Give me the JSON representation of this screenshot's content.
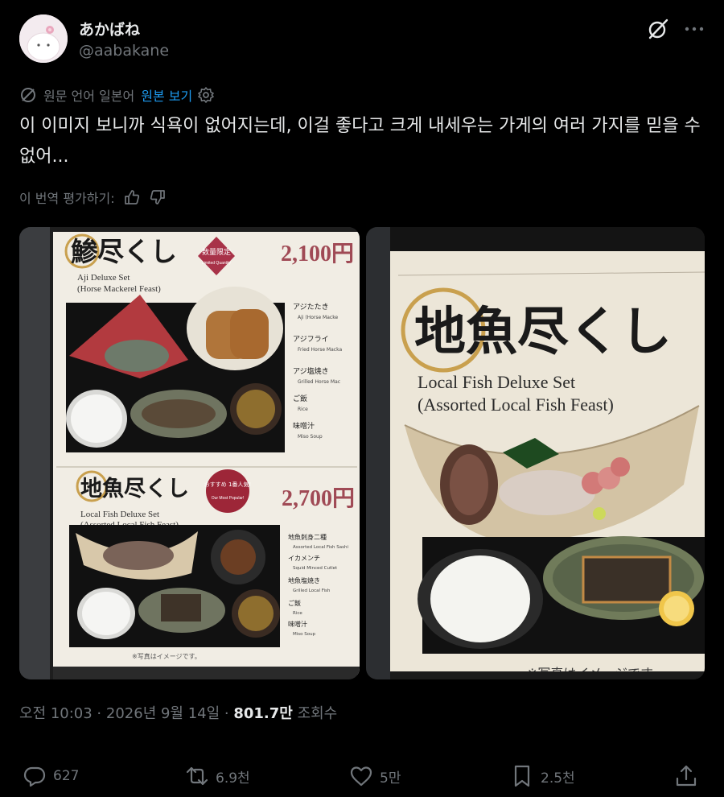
{
  "author": {
    "display_name": "あかばね",
    "handle": "@aabakane"
  },
  "translation": {
    "source_language": "원문 언어 일본어",
    "show_original": "원본 보기",
    "rate_label": "이 번역 평가하기:"
  },
  "tweet": {
    "text": "이 이미지 보니까 식욕이 없어지는데, 이걸 좋다고 크게 내세우는 가게의 여러 가지를 믿을 수 없어..."
  },
  "photo_left": {
    "set1_title": "鯵尽くし",
    "set1_en": "Aji Deluxe Set",
    "set1_en_sub": "(Horse Mackerel Feast)",
    "set1_badge": "数量限定",
    "set1_badge_en": "Limited Quantity",
    "set1_price": "2,100円",
    "set1_items": [
      {
        "jp": "アジたたき",
        "en": "Aji (Horse Macke"
      },
      {
        "jp": "アジフライ",
        "en": "Fried Horse Macka"
      },
      {
        "jp": "アジ塩焼き",
        "en": "Grilled Horse Mac"
      },
      {
        "jp": "ご飯",
        "en": "Rice"
      },
      {
        "jp": "味噌汁",
        "en": "Miso Soup"
      }
    ],
    "set2_title": "地魚尽くし",
    "set2_en": "Local Fish Deluxe Set",
    "set2_en_sub": "(Assorted Local Fish Feast)",
    "set2_badge": "おすすめ 1番人気!",
    "set2_badge_en": "Our Most Popular!",
    "set2_price": "2,700円",
    "set2_items": [
      {
        "jp": "地魚刺身二種",
        "en": "Assorted Local Fish Sashi"
      },
      {
        "jp": "イカメンチ",
        "en": "Squid Minced Cutlet"
      },
      {
        "jp": "地魚塩焼き",
        "en": "Grilled Local Fish"
      },
      {
        "jp": "ご飯",
        "en": "Rice"
      },
      {
        "jp": "味噌汁",
        "en": "Miso Soup"
      }
    ],
    "note": "※写真はイメージです。"
  },
  "photo_right": {
    "title": "地魚尽くし",
    "en": "Local Fish Deluxe Set",
    "en_sub": "(Assorted Local Fish Feast)",
    "note": "※写真はイメージです。"
  },
  "meta": {
    "time": "오전 10:03 · 2026년 9월 14일 · ",
    "views_count": "801.7만",
    "views_label": " 조회수"
  },
  "actions": {
    "replies": "627",
    "reposts": "6.9천",
    "likes": "5만",
    "bookmarks": "2.5천"
  },
  "icons": [
    "grok-icon",
    "more-icon",
    "translate-icon",
    "settings-icon",
    "thumbs-up-icon",
    "thumbs-down-icon",
    "reply-icon",
    "repost-icon",
    "like-icon",
    "bookmark-icon",
    "share-icon"
  ],
  "colors": {
    "background": "#000000",
    "text": "#e7e9ea",
    "muted": "#71767b",
    "link": "#1d9bf0"
  }
}
